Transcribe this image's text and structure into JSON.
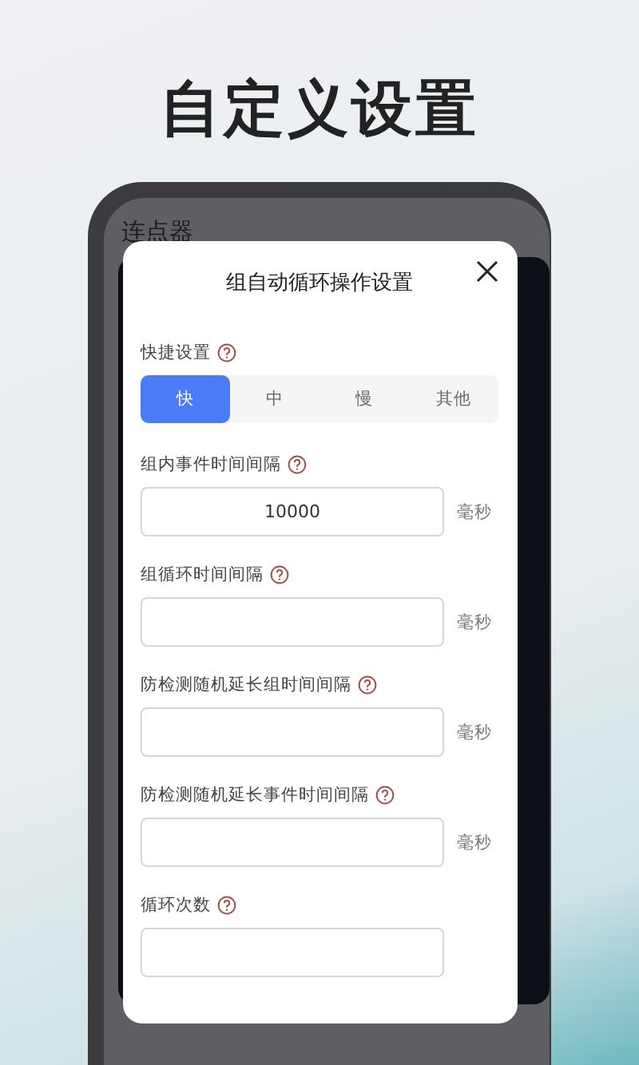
{
  "headline": "自定义设置",
  "app": {
    "title": "连点器"
  },
  "dialog": {
    "title": "组自动循环操作设置",
    "speed": {
      "label": "快捷设置",
      "options": [
        {
          "label": "快",
          "selected": true
        },
        {
          "label": "中",
          "selected": false
        },
        {
          "label": "慢",
          "selected": false
        },
        {
          "label": "其他",
          "selected": false
        }
      ]
    },
    "fields": [
      {
        "label": "组内事件时间间隔",
        "value": "10000",
        "unit": "毫秒"
      },
      {
        "label": "组循环时间间隔",
        "unit": "毫秒"
      },
      {
        "label": "防检测随机延长组时间间隔",
        "unit": "毫秒"
      },
      {
        "label": "防检测随机延长事件时间间隔",
        "unit": "毫秒"
      },
      {
        "label": "循环次数"
      }
    ]
  }
}
